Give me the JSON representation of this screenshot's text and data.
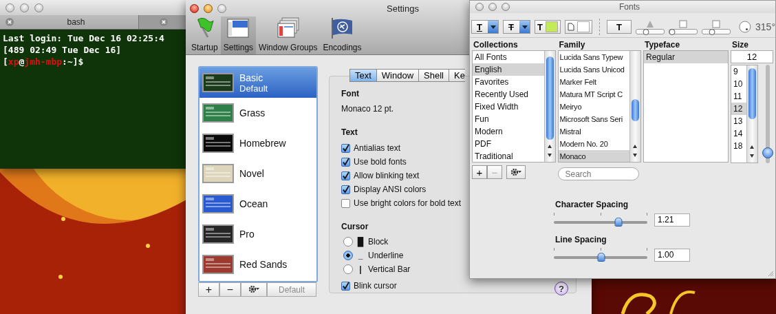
{
  "terminal": {
    "tab": "bash",
    "lines": [
      {
        "segments": [
          {
            "text": "Last login: Tue Dec 16 02:25:4",
            "color": "#ffffff"
          }
        ]
      },
      {
        "segments": [
          {
            "text": "[489 02:49 Tue Dec 16]",
            "color": "#ffffff"
          }
        ]
      },
      {
        "segments": [
          {
            "text": "[",
            "color": "#ffffff"
          },
          {
            "text": "xp",
            "color": "#e01010"
          },
          {
            "text": "@",
            "color": "#ffffff"
          },
          {
            "text": "jmh-mbp",
            "color": "#e01010"
          },
          {
            "text": ":~]$",
            "color": "#ffffff"
          }
        ]
      }
    ]
  },
  "settings": {
    "title": "Settings",
    "toolbar": [
      {
        "label": "Startup",
        "kind": "flag",
        "selected": false
      },
      {
        "label": "Settings",
        "kind": "panel",
        "selected": true
      },
      {
        "label": "Window Groups",
        "kind": "windows",
        "selected": false
      },
      {
        "label": "Encodings",
        "kind": "globe",
        "selected": false
      }
    ],
    "profiles": [
      {
        "name": "Basic",
        "note": "Default",
        "color": "#1c3a1c",
        "selected": true
      },
      {
        "name": "Grass",
        "color": "#2e8048",
        "selected": false
      },
      {
        "name": "Homebrew",
        "color": "#0a0a0a",
        "selected": false
      },
      {
        "name": "Novel",
        "color": "#ddd6bc",
        "selected": false
      },
      {
        "name": "Ocean",
        "color": "#2a5ad0",
        "selected": false
      },
      {
        "name": "Pro",
        "color": "#262626",
        "selected": false
      },
      {
        "name": "Red Sands",
        "color": "#9c3a30",
        "selected": false
      }
    ],
    "list_buttons": {
      "add": "+",
      "remove": "−",
      "default": "Default"
    },
    "tabs": [
      {
        "label": "Text",
        "selected": true
      },
      {
        "label": "Window",
        "selected": false
      },
      {
        "label": "Shell",
        "selected": false
      },
      {
        "label": "Ke",
        "selected": false
      }
    ],
    "font_heading": "Font",
    "font_value": "Monaco 12 pt.",
    "text_heading": "Text",
    "text_options": [
      {
        "label": "Antialias text",
        "checked": true
      },
      {
        "label": "Use bold fonts",
        "checked": true
      },
      {
        "label": "Allow blinking text",
        "checked": true
      },
      {
        "label": "Display ANSI colors",
        "checked": true
      },
      {
        "label": "Use bright colors for bold text",
        "checked": false
      }
    ],
    "cursor_heading": "Cursor",
    "cursor_options": [
      {
        "glyph": "█",
        "label": "Block",
        "selected": false
      },
      {
        "glyph": "_",
        "label": "Underline",
        "selected": true
      },
      {
        "glyph": "|",
        "label": "Vertical Bar",
        "selected": false
      }
    ],
    "blink": {
      "label": "Blink cursor",
      "checked": true
    },
    "help": "?"
  },
  "fonts": {
    "title": "Fonts",
    "toolbar": {
      "underline": "T",
      "strikethrough": "T",
      "text_color": {
        "label": "T",
        "color": "#c4ea5a"
      },
      "document_color": {
        "color": "#ffffff"
      },
      "shadow": "T",
      "shadow_sliders": [
        {
          "level": 0.35
        },
        {
          "level": 0.1
        },
        {
          "level": 0.35
        }
      ],
      "angle": "315°"
    },
    "headers": {
      "collections": "Collections",
      "family": "Family",
      "typeface": "Typeface",
      "size": "Size"
    },
    "collections": [
      {
        "label": "All Fonts",
        "selected": false
      },
      {
        "label": "English",
        "selected": true
      },
      {
        "label": "Favorites",
        "selected": false
      },
      {
        "label": "Recently Used",
        "selected": false
      },
      {
        "label": "Fixed Width",
        "selected": false
      },
      {
        "label": "Fun",
        "selected": false
      },
      {
        "label": "Modern",
        "selected": false
      },
      {
        "label": "PDF",
        "selected": false
      },
      {
        "label": "Traditional",
        "selected": false
      }
    ],
    "families": [
      {
        "label": "Lucida Sans Typew",
        "selected": false
      },
      {
        "label": "Lucida Sans Unicod",
        "selected": false
      },
      {
        "label": "Marker Felt",
        "selected": false
      },
      {
        "label": "Matura MT Script C",
        "selected": false
      },
      {
        "label": "Meiryo",
        "selected": false
      },
      {
        "label": "Microsoft Sans Seri",
        "selected": false
      },
      {
        "label": "Mistral",
        "selected": false
      },
      {
        "label": "Modern No. 20",
        "selected": false
      },
      {
        "label": "Monaco",
        "selected": true
      }
    ],
    "typefaces": [
      {
        "label": "Regular",
        "selected": true
      }
    ],
    "size_value": "12",
    "sizes": [
      {
        "label": "9",
        "selected": false
      },
      {
        "label": "10",
        "selected": false
      },
      {
        "label": "11",
        "selected": false
      },
      {
        "label": "12",
        "selected": true
      },
      {
        "label": "13",
        "selected": false
      },
      {
        "label": "14",
        "selected": false
      },
      {
        "label": "18",
        "selected": false
      }
    ],
    "size_slider": {
      "level": 0.05
    },
    "collection_buttons": {
      "add": "+",
      "remove": "−"
    },
    "search": {
      "placeholder": "Search"
    },
    "spacing": [
      {
        "label": "Character Spacing",
        "level": 0.69,
        "value": "1.21"
      },
      {
        "label": "Line Spacing",
        "level": 0.51,
        "value": "1.00"
      }
    ]
  }
}
